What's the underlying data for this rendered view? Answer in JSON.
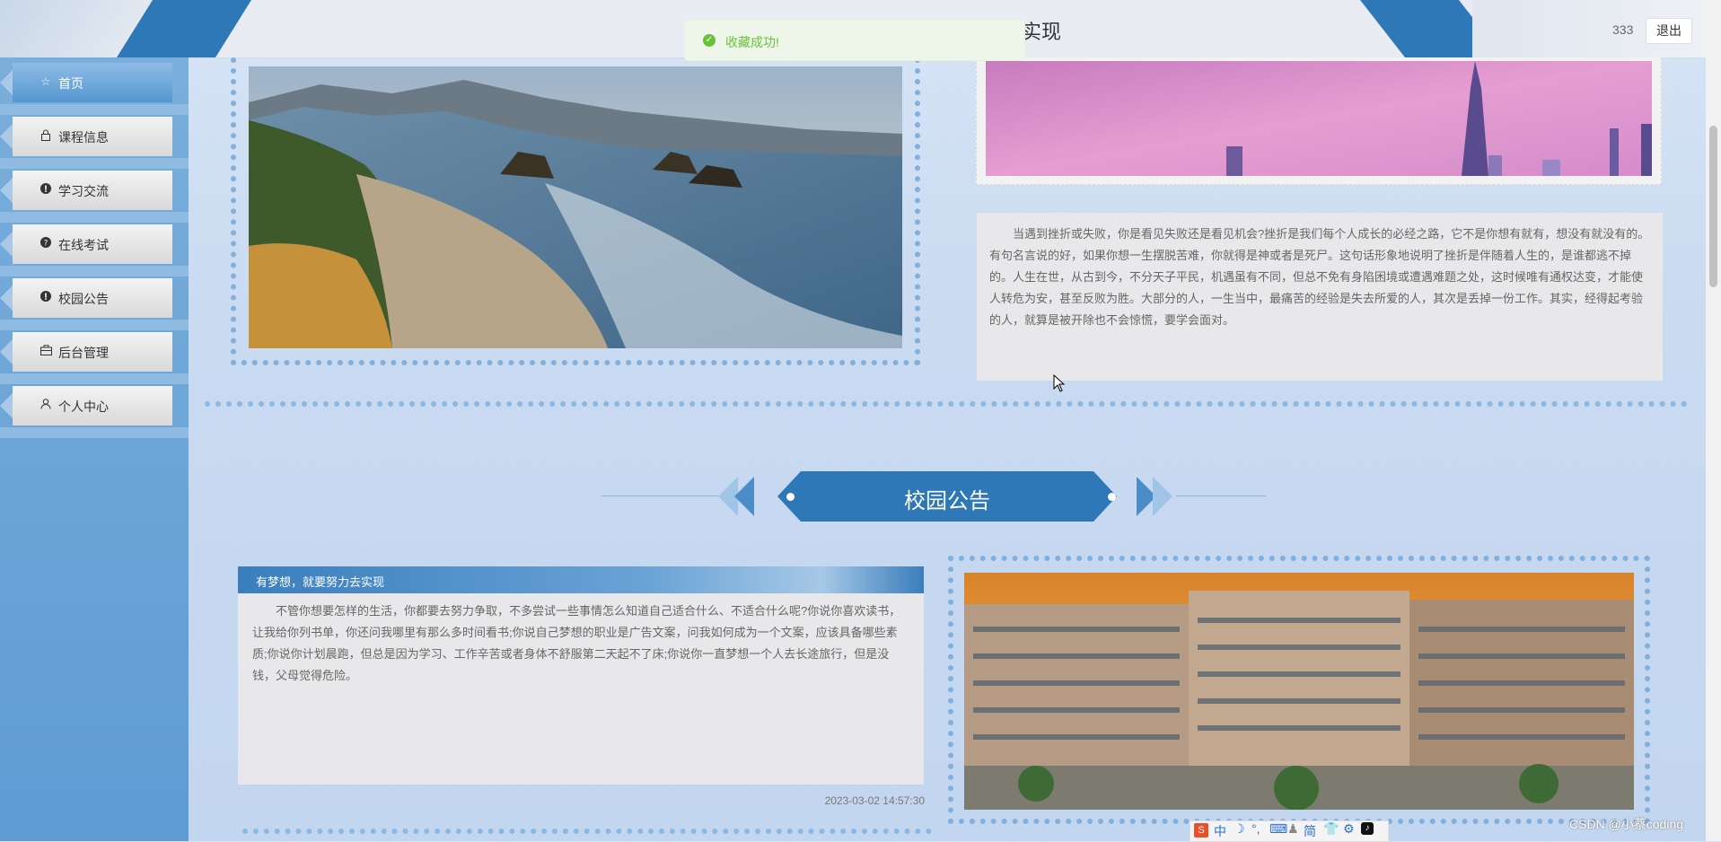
{
  "header": {
    "title": "实现",
    "username": "333",
    "logout_label": "退出"
  },
  "toast": {
    "message": "收藏成功!",
    "color": "#67c23a"
  },
  "sidebar": {
    "items": [
      {
        "label": "首页",
        "icon": "star-icon",
        "active": true
      },
      {
        "label": "课程信息",
        "icon": "lock-icon",
        "active": false
      },
      {
        "label": "学习交流",
        "icon": "info-icon",
        "active": false
      },
      {
        "label": "在线考试",
        "icon": "question-icon",
        "active": false
      },
      {
        "label": "校园公告",
        "icon": "info-icon",
        "active": false
      },
      {
        "label": "后台管理",
        "icon": "briefcase-icon",
        "active": false
      },
      {
        "label": "个人中心",
        "icon": "user-icon",
        "active": false
      }
    ]
  },
  "top_section": {
    "right_text": "当遇到挫折或失败，你是看见失败还是看见机会?挫折是我们每个人成长的必经之路，它不是你想有就有，想没有就没有的。有句名言说的好，如果你想一生摆脱苦难，你就得是神或者是死尸。这句话形象地说明了挫折是伴随着人生的，是谁都逃不掉的。人生在世，从古到今，不分天子平民，机遇虽有不同，但总不免有身陷困境或遭遇难题之处，这时候唯有通权达变，才能使人转危为安，甚至反败为胜。大部分的人，一生当中，最痛苦的经验是失去所爱的人，其次是丢掉一份工作。其实，经得起考验的人，就算是被开除也不会惊慌，要学会面对。"
  },
  "notice_section": {
    "title": "校园公告",
    "item": {
      "headline": "有梦想，就要努力去实现",
      "body": "不管你想要怎样的生活，你都要去努力争取，不多尝试一些事情怎么知道自己适合什么、不适合什么呢?你说你喜欢读书，让我给你列书单，你还问我哪里有那么多时间看书;你说自己梦想的职业是广告文案，问我如何成为一个文案，应该具备哪些素质;你说你计划晨跑，但总是因为学习、工作辛苦或者身体不舒服第二天起不了床;你说你一直梦想一个人去长途旅行，但是没钱，父母觉得危险。",
      "date": "2023-03-02 14:57:30"
    }
  },
  "ime_toolbar": {
    "items": [
      "中",
      "简"
    ]
  },
  "watermark": "CSDN @小蔡coding",
  "colors": {
    "accent": "#2f78b8",
    "dots": "#7fb0de"
  }
}
